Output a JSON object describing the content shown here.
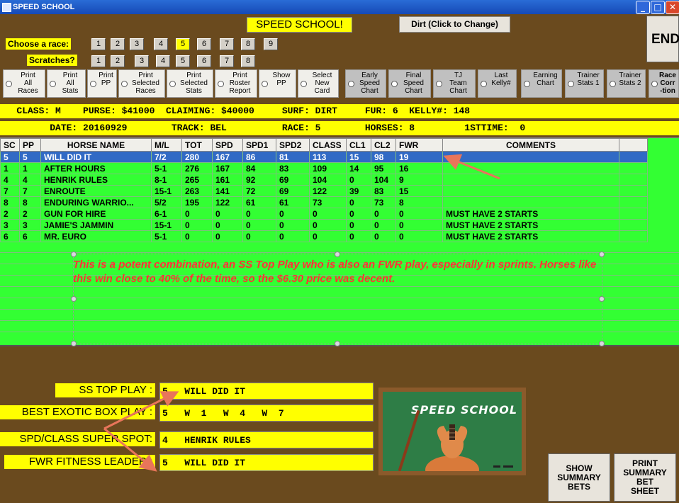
{
  "window": {
    "title": "SPEED SCHOOL"
  },
  "header": {
    "title": "SPEED SCHOOL!",
    "surface_button": "Dirt (Click to Change)",
    "end_button": "END"
  },
  "race_selector": {
    "label": "Choose  a race:",
    "buttons": [
      "1",
      "2",
      "3",
      "4",
      "5",
      "6",
      "7",
      "8",
      "9"
    ],
    "selected": "5"
  },
  "scratches": {
    "label": "Scratches?",
    "buttons": [
      "1",
      "2",
      "3",
      "4",
      "5",
      "6",
      "7",
      "8"
    ]
  },
  "options": [
    {
      "label": "Print\nAll\nRaces"
    },
    {
      "label": "Print\nAll\nStats"
    },
    {
      "label": "Print\nPP"
    },
    {
      "label": "Print\nSelected\nRaces"
    },
    {
      "label": "Print\nSelected\nStats"
    },
    {
      "label": "Print\nRoster\nReport"
    },
    {
      "label": "Show\nPP"
    },
    {
      "label": "Select\nNew\nCard"
    },
    {
      "label": "Early\nSpeed\nChart"
    },
    {
      "label": "Final\nSpeed\nChart"
    },
    {
      "label": "TJ\nTeam\nChart"
    },
    {
      "label": "Last\nKelly#"
    },
    {
      "label": "Earning\nChart"
    },
    {
      "label": "Trainer\nStats 1"
    },
    {
      "label": "Trainer\nStats 2"
    },
    {
      "label": "Race\nCorr\n-tion"
    }
  ],
  "race_info": {
    "line1": "   CLASS: M    PURSE: $41000  CLAIMING: $40000     SURF: DIRT     FUR: 6  KELLY#: 148",
    "line2": "         DATE: 20160929        TRACK: BEL          RACE: 5        HORSES: 8         1STTIME:  0"
  },
  "table": {
    "columns": [
      "SC",
      "PP",
      "HORSE NAME",
      "M/L",
      "TOT",
      "SPD",
      "SPD1",
      "SPD2",
      "CLASS",
      "CL1",
      "CL2",
      "FWR",
      "COMMENTS"
    ],
    "rows": [
      [
        "5",
        "5",
        "WILL DID IT",
        "7/2",
        "280",
        "167",
        "86",
        "81",
        "113",
        "15",
        "98",
        "19",
        ""
      ],
      [
        "1",
        "1",
        "AFTER HOURS",
        "5-1",
        "276",
        "167",
        "84",
        "83",
        "109",
        "14",
        "95",
        "16",
        ""
      ],
      [
        "4",
        "4",
        "HENRIK RULES",
        "8-1",
        "265",
        "161",
        "92",
        "69",
        "104",
        "0",
        "104",
        "9",
        ""
      ],
      [
        "7",
        "7",
        "ENROUTE",
        "15-1",
        "263",
        "141",
        "72",
        "69",
        "122",
        "39",
        "83",
        "15",
        ""
      ],
      [
        "8",
        "8",
        "ENDURING WARRIO...",
        "5/2",
        "195",
        "122",
        "61",
        "61",
        "73",
        "0",
        "73",
        "8",
        ""
      ],
      [
        "2",
        "2",
        "GUN FOR HIRE",
        "6-1",
        "0",
        "0",
        "0",
        "0",
        "0",
        "0",
        "0",
        "0",
        "MUST HAVE 2 STARTS"
      ],
      [
        "3",
        "3",
        "JAMIE'S JAMMIN",
        "15-1",
        "0",
        "0",
        "0",
        "0",
        "0",
        "0",
        "0",
        "0",
        "MUST HAVE 2 STARTS"
      ],
      [
        "6",
        "6",
        "MR. EURO",
        "5-1",
        "0",
        "0",
        "0",
        "0",
        "0",
        "0",
        "0",
        "0",
        "MUST HAVE 2 STARTS"
      ]
    ]
  },
  "annotation": {
    "text": "This is a potent combination, an SS Top Play who is also an FWR play, especially in sprints.  Horses like this win close to 40% of the time, so the $6.30 price was decent."
  },
  "plays": {
    "top_play_label": "SS TOP PLAY :",
    "top_play_value": "5   WILL DID IT",
    "exotic_label": "BEST EXOTIC BOX PLAY :",
    "exotic_value": "5   W  1   W  4   W  7",
    "super_spot_label": "SPD/CLASS SUPER SPOT:",
    "super_spot_value": "4   HENRIK RULES",
    "fitness_label": "FWR FITNESS LEADER :",
    "fitness_value": "5   WILL DID IT"
  },
  "logo": {
    "text": "SPEED SCHOOL"
  },
  "summary": {
    "show_label": "SHOW\nSUMMARY\nBETS",
    "print_label": "PRINT\nSUMMARY\nBET\nSHEET"
  },
  "colors": {
    "highlight": "#ffff00",
    "grid": "#33ff33",
    "selected_row": "#316ac5",
    "note": "#ff3333",
    "arrow": "#e8755a"
  }
}
